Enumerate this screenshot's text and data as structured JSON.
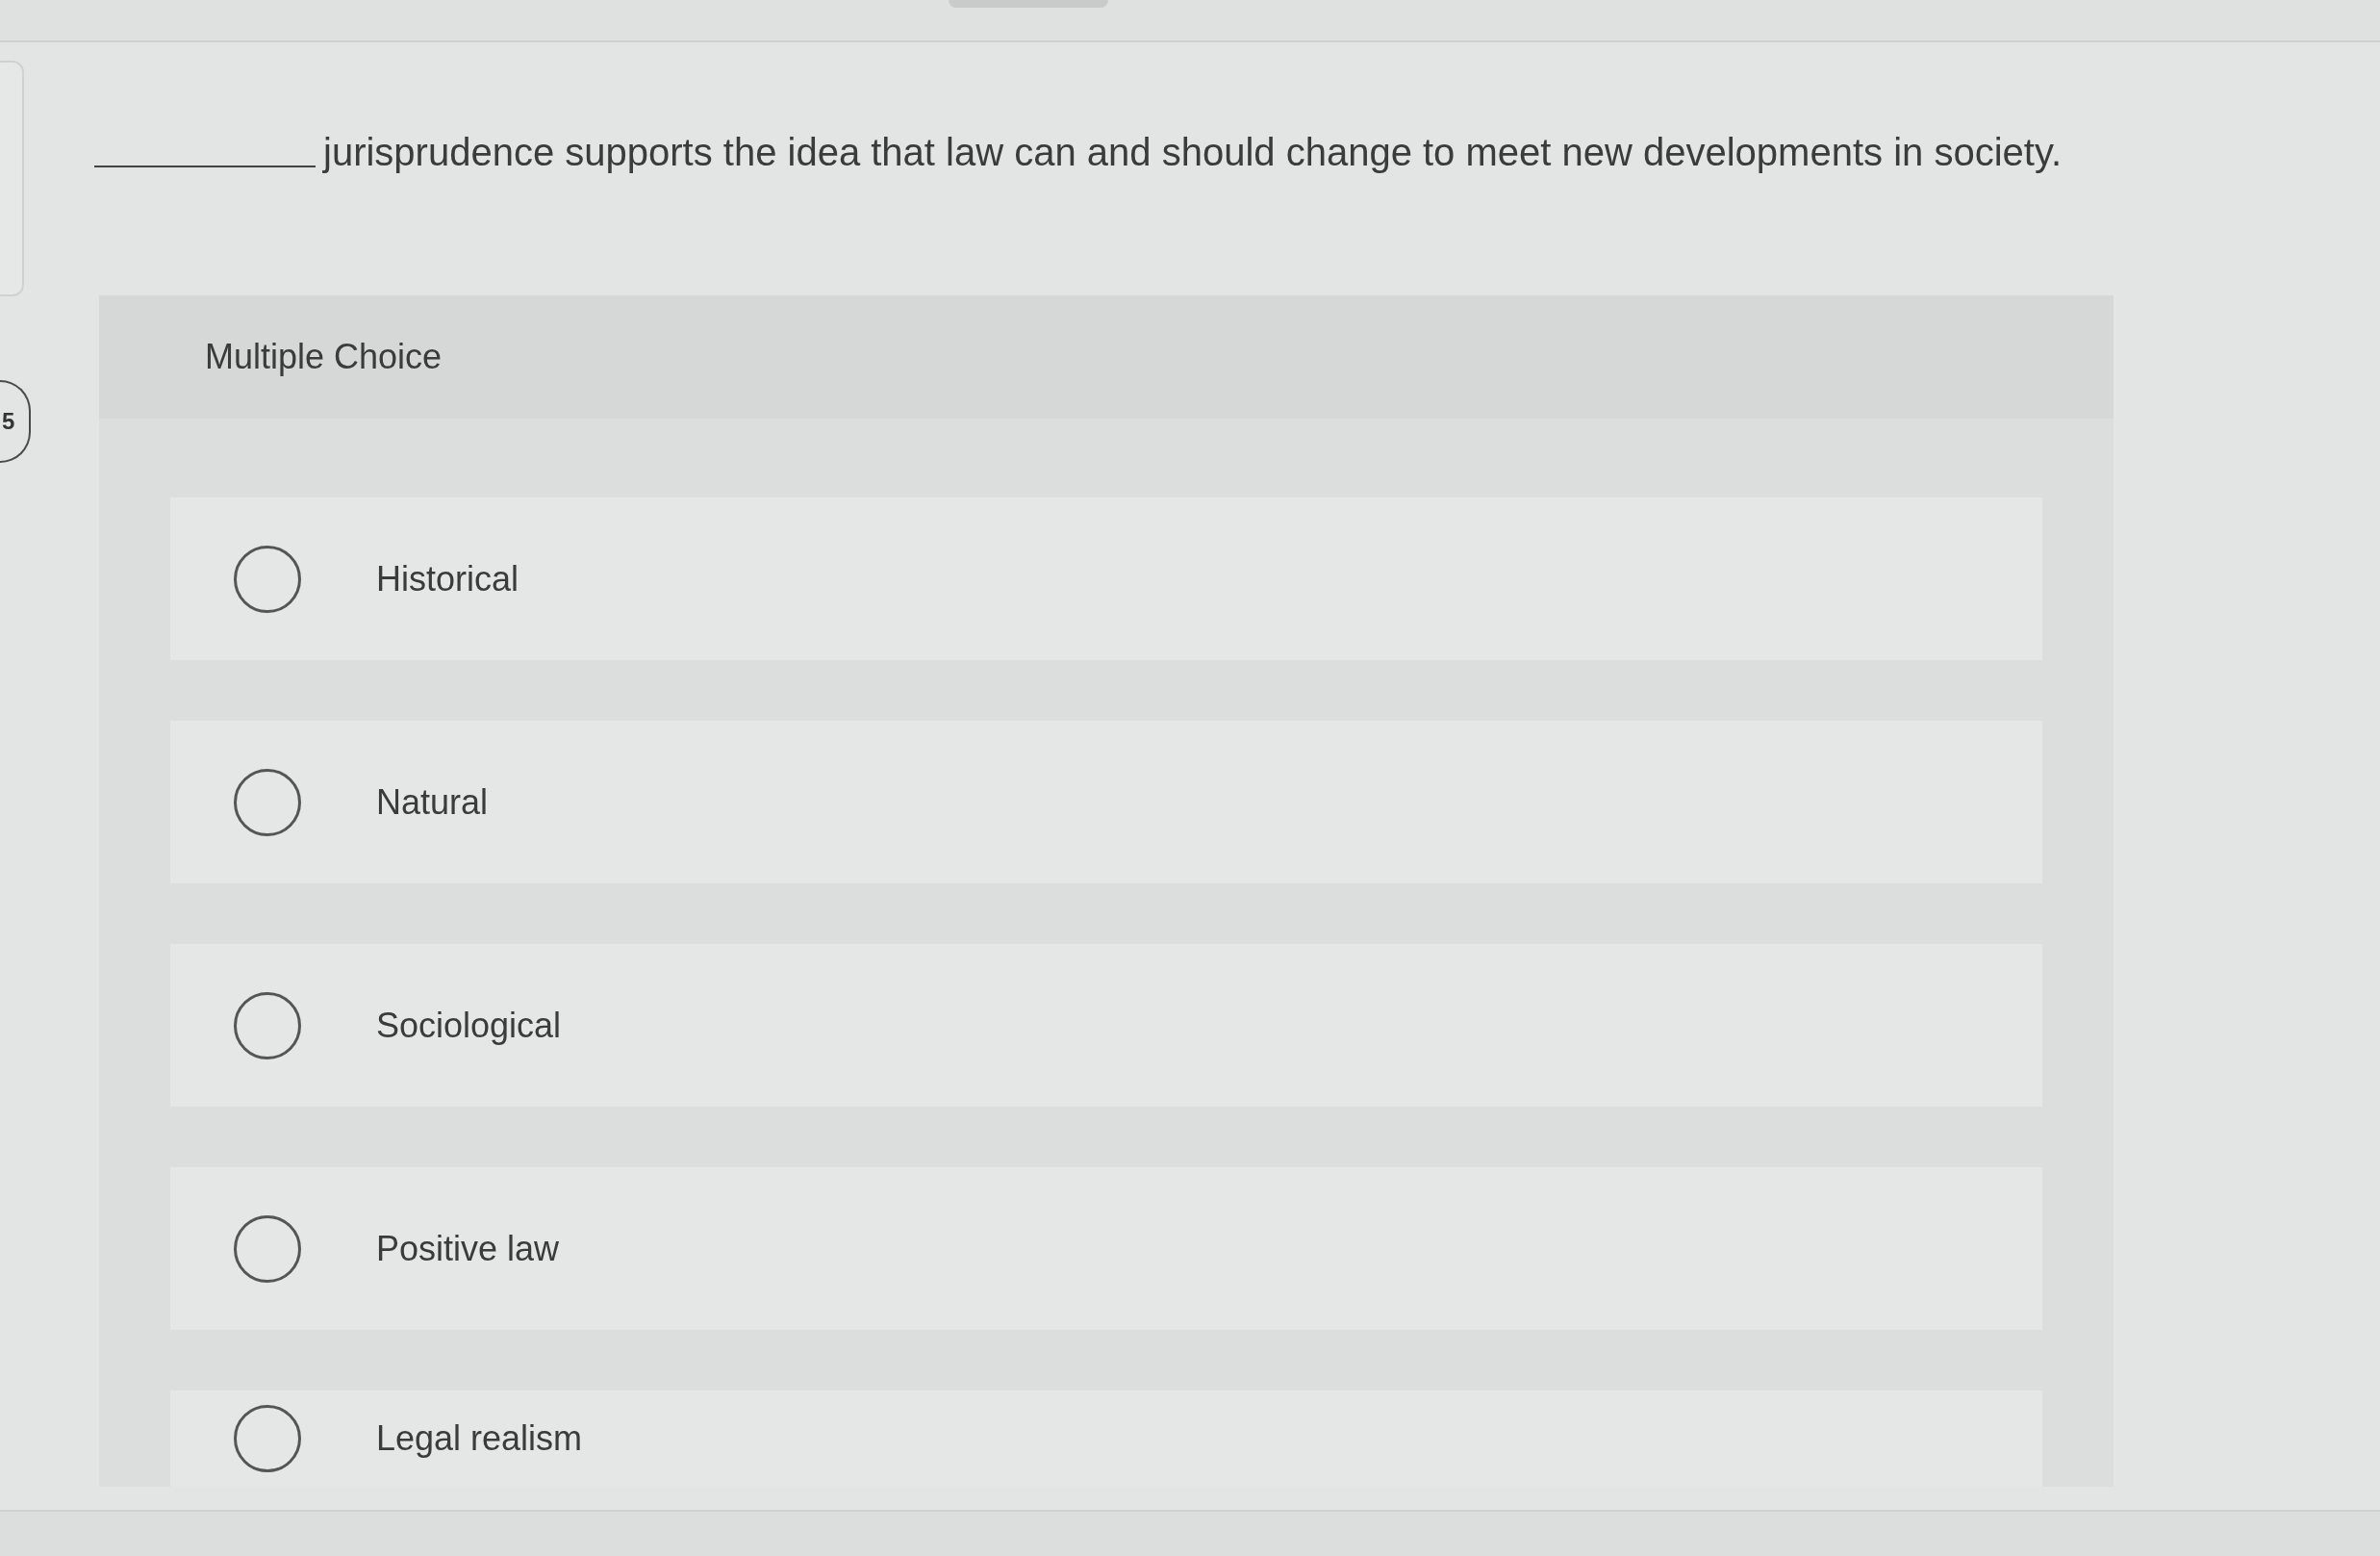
{
  "question_number": "5",
  "question": {
    "text": "jurisprudence supports the idea that law can and should change to meet new developments in society."
  },
  "multiple_choice": {
    "heading": "Multiple Choice",
    "options": [
      {
        "label": "Historical",
        "selected": false
      },
      {
        "label": "Natural",
        "selected": false
      },
      {
        "label": "Sociological",
        "selected": false
      },
      {
        "label": "Positive law",
        "selected": false
      },
      {
        "label": "Legal realism",
        "selected": false
      }
    ]
  }
}
